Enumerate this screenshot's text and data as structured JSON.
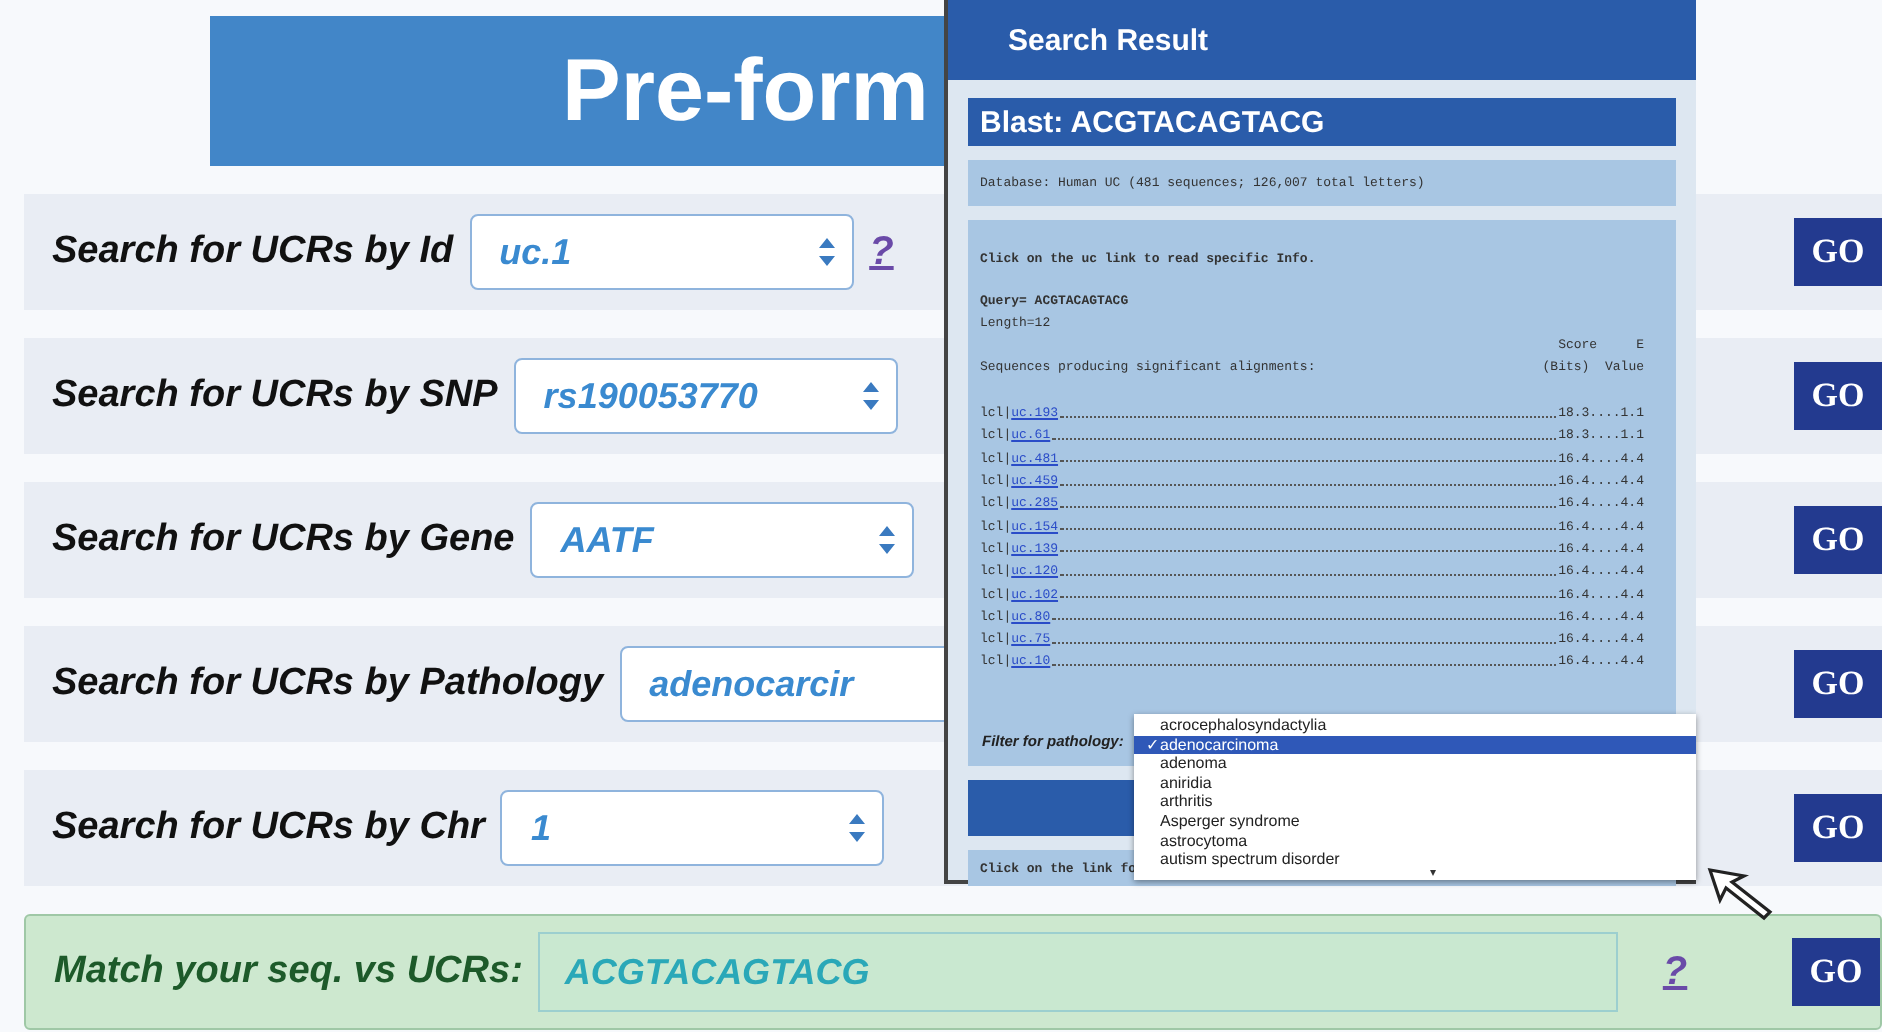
{
  "header": {
    "title": "Pre-form"
  },
  "search_rows": [
    {
      "label": "Search for UCRs by Id",
      "value": "uc.1",
      "arrows": true,
      "help": "?",
      "button": "GO"
    },
    {
      "label": "Search for UCRs by SNP",
      "value": "rs190053770",
      "arrows": true,
      "button": "GO"
    },
    {
      "label": "Search for UCRs by Gene",
      "value": "AATF",
      "arrows": true,
      "button": "GO"
    },
    {
      "label": "Search for UCRs by Pathology",
      "value": "adenocarcir",
      "arrows": false,
      "button": "GO"
    },
    {
      "label": "Search for UCRs by Chr",
      "value": "1",
      "arrows": true,
      "button": "GO"
    }
  ],
  "match_row": {
    "label": "Match your seq. vs UCRs:",
    "value": "ACGTACAGTACG",
    "help": "?",
    "button": "GO"
  },
  "result_window": {
    "title": "Search Result",
    "blast_title": "Blast: ACGTACAGTACG",
    "database": "Database: Human UC (481 sequences; 126,007 total letters)",
    "instruction": "Click on the uc link to read specific Info.",
    "query": "Query= ACGTACAGTACG",
    "length": "Length=12",
    "alignments_heading": "Sequences producing significant alignments:",
    "score_heading": [
      "Score     E",
      "(Bits)  Value"
    ],
    "hits": [
      {
        "prefix": "lcl|",
        "id": "uc.193",
        "tail": "18.3....1.1"
      },
      {
        "prefix": "lcl|",
        "id": "uc.61",
        "tail": "18.3....1.1"
      },
      {
        "prefix": "lcl|",
        "id": "uc.481",
        "tail": "16.4....4.4"
      },
      {
        "prefix": "lcl|",
        "id": "uc.459",
        "tail": "16.4....4.4"
      },
      {
        "prefix": "lcl|",
        "id": "uc.285",
        "tail": "16.4....4.4"
      },
      {
        "prefix": "lcl|",
        "id": "uc.154",
        "tail": "16.4....4.4"
      },
      {
        "prefix": "lcl|",
        "id": "uc.139",
        "tail": "16.4....4.4"
      },
      {
        "prefix": "lcl|",
        "id": "uc.120",
        "tail": "16.4....4.4"
      },
      {
        "prefix": "lcl|",
        "id": "uc.102",
        "tail": "16.4....4.4"
      },
      {
        "prefix": "lcl|",
        "id": "uc.80",
        "tail": "16.4....4.4"
      },
      {
        "prefix": "lcl|",
        "id": "uc.75",
        "tail": "16.4....4.4"
      },
      {
        "prefix": "lcl|",
        "id": "uc.10",
        "tail": "16.4....4.4"
      }
    ],
    "filter_label": "Filter for pathology:",
    "footer_text": "Click on the link fo",
    "dropdown": [
      {
        "label": "acrocephalosyndactylia",
        "selected": false
      },
      {
        "label": "adenocarcinoma",
        "selected": true
      },
      {
        "label": "adenoma",
        "selected": false
      },
      {
        "label": "aniridia",
        "selected": false
      },
      {
        "label": "arthritis",
        "selected": false
      },
      {
        "label": "Asperger syndrome",
        "selected": false
      },
      {
        "label": "astrocytoma",
        "selected": false
      },
      {
        "label": "autism spectrum disorder",
        "selected": false
      }
    ],
    "check_mark": "✓",
    "more_mark": "▾"
  }
}
